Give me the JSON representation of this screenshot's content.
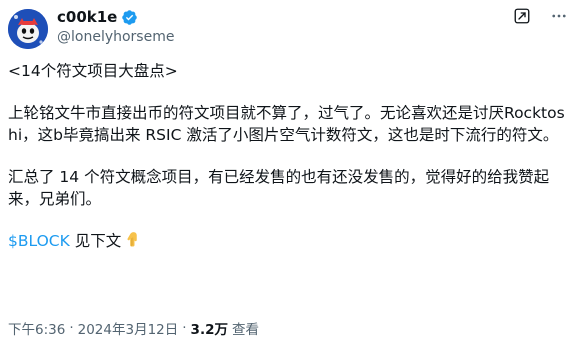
{
  "author": {
    "display_name": "c00k1e",
    "handle": "@lonelyhorseme",
    "verified": true,
    "avatar": "cartoon-character-avatar"
  },
  "header_actions": {
    "grok_icon": "grok-icon",
    "more_icon": "more-horizontal-icon"
  },
  "tweet": {
    "line1": "<14个符文项目大盘点>",
    "para2": "上轮铭文牛市直接出币的符文项目就不算了，过气了。无论喜欢还是讨厌Rocktoshi，这b毕竟搞出来 RSIC 激活了小图片空气计数符文，这也是时下流行的符文。",
    "para3": "汇总了 14 个符文概念项目，有已经发售的也有还没发售的，觉得好的给我赞起来，兄弟们。",
    "cashtag": "$BLOCK",
    "cashtag_suffix": " 见下文",
    "emoji": "pointing-down-hand-icon"
  },
  "meta": {
    "time": "下午6:36",
    "separator": "·",
    "date": "2024年3月12日",
    "views_count": "3.2万",
    "views_label": "查看"
  },
  "colors": {
    "text": "#0f1419",
    "secondary": "#536471",
    "link": "#1d9bf0",
    "verified": "#1d9bf0"
  }
}
